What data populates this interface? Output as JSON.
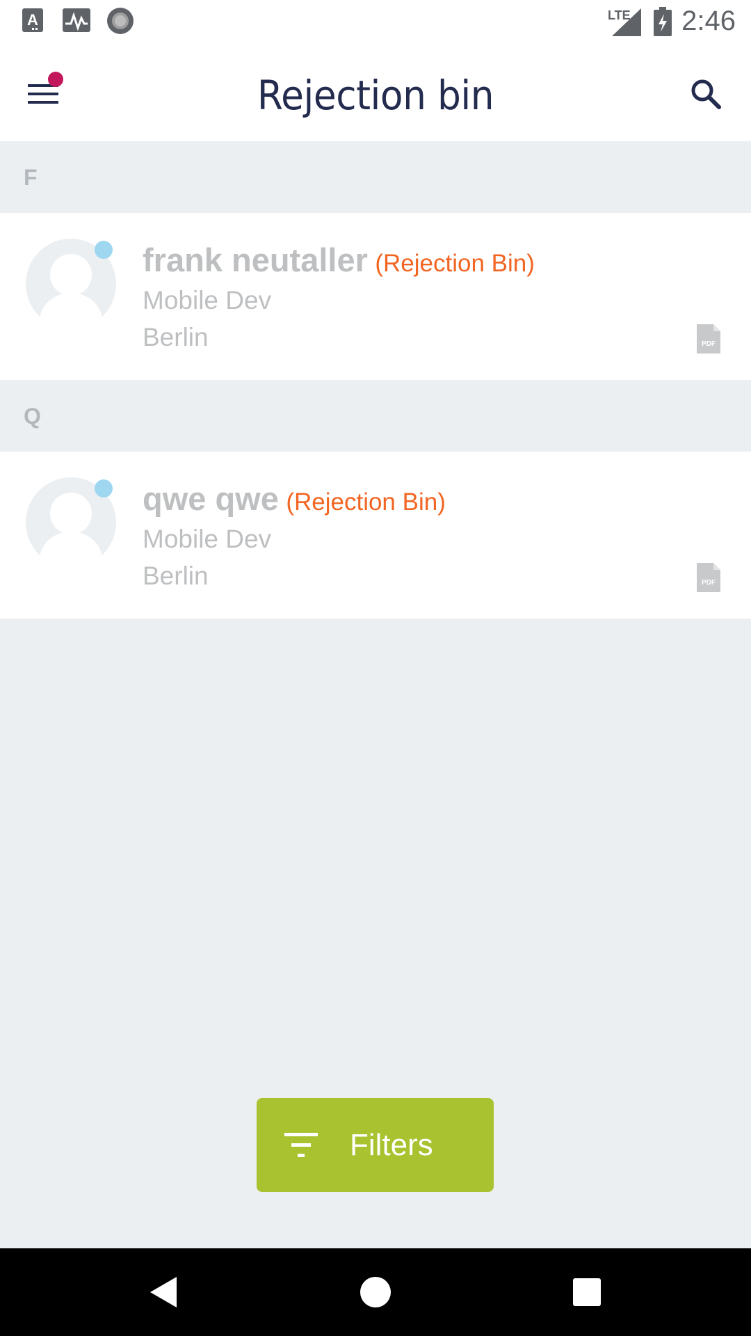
{
  "status_bar": {
    "time": "2:46",
    "network": "LTE",
    "left_icons": [
      "text-a-icon",
      "activity-icon",
      "record-icon"
    ],
    "right_icons": [
      "signal-icon",
      "battery-charging-icon"
    ]
  },
  "app_bar": {
    "title": "Rejection bin",
    "menu_icon": "hamburger-menu-icon",
    "notification_dot_color": "#c2185b",
    "search_icon": "search-icon"
  },
  "sections": [
    {
      "letter": "F",
      "candidate": {
        "name": "frank neutaller",
        "tag": "(Rejection Bin)",
        "role": "Mobile Dev",
        "city": "Berlin",
        "attachment_icon": "pdf-icon"
      }
    },
    {
      "letter": "Q",
      "candidate": {
        "name": "qwe qwe",
        "tag": "(Rejection Bin)",
        "role": "Mobile Dev",
        "city": "Berlin",
        "attachment_icon": "pdf-icon"
      }
    }
  ],
  "filters_button": {
    "label": "Filters",
    "icon": "filter-icon",
    "color": "#a8c230"
  },
  "colors": {
    "tag_color": "#f26522",
    "title_color": "#232b4e",
    "online_dot": "#9ed7ef"
  },
  "nav_bar": {
    "icons": [
      "back-icon",
      "home-icon",
      "recents-icon"
    ]
  }
}
